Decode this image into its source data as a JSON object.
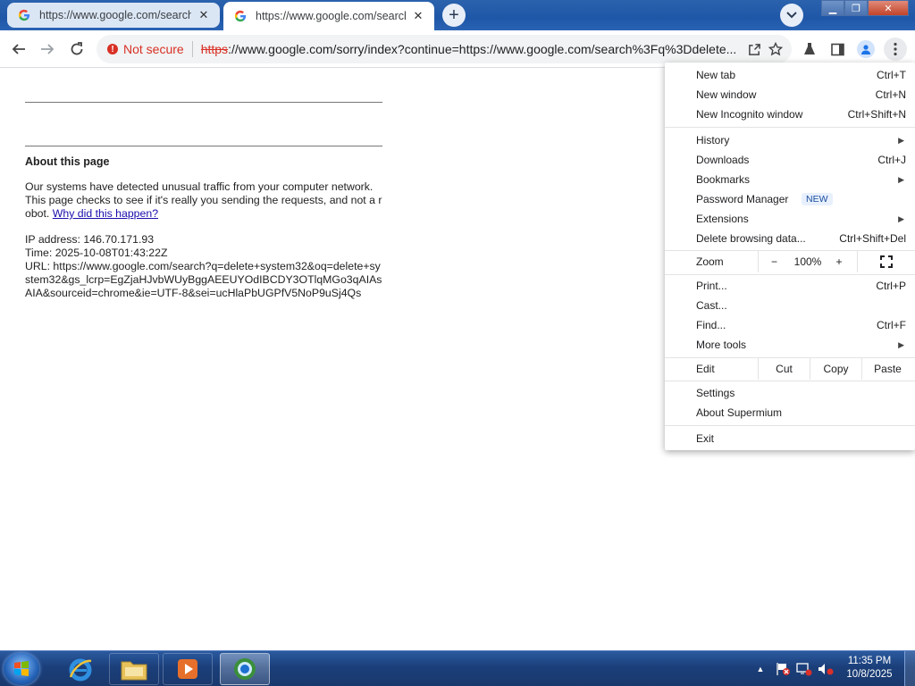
{
  "tabs": [
    {
      "title": "https://www.google.com/search?",
      "active": false
    },
    {
      "title": "https://www.google.com/search?",
      "active": true
    }
  ],
  "toolbar": {
    "security_label": "Not secure",
    "url_scheme": "https",
    "url_rest": "://www.google.com/sorry/index?continue=https://www.google.com/search%3Fq%3Ddelete..."
  },
  "page": {
    "heading": "About this page",
    "message": "Our systems have detected unusual traffic from your computer network. This page checks to see if it's really you sending the requests, and not a robot.",
    "link_text": "Why did this happen?",
    "ip_line": "IP address: 146.70.171.93",
    "time_line": "Time: 2025-10-08T01:43:22Z",
    "url_line": "URL: https://www.google.com/search?q=delete+system32&oq=delete+system32&gs_lcrp=EgZjaHJvbWUyBggAEEUYOdIBCDY3OTlqMGo3qAIAsAIA&sourceid=chrome&ie=UTF-8&sei=ucHlaPbUGPfV5NoP9uSj4Qs"
  },
  "menu": {
    "items": [
      {
        "label": "New tab",
        "shortcut": "Ctrl+T"
      },
      {
        "label": "New window",
        "shortcut": "Ctrl+N"
      },
      {
        "label": "New Incognito window",
        "shortcut": "Ctrl+Shift+N"
      },
      {
        "label": "History",
        "shortcut": ""
      },
      {
        "label": "Downloads",
        "shortcut": "Ctrl+J"
      },
      {
        "label": "Bookmarks",
        "shortcut": ""
      },
      {
        "label": "Password Manager",
        "shortcut": ""
      },
      {
        "label": "Extensions",
        "shortcut": ""
      },
      {
        "label": "Delete browsing data...",
        "shortcut": "Ctrl+Shift+Del"
      },
      {
        "label": "Print...",
        "shortcut": "Ctrl+P"
      },
      {
        "label": "Cast...",
        "shortcut": ""
      },
      {
        "label": "Find...",
        "shortcut": "Ctrl+F"
      },
      {
        "label": "More tools",
        "shortcut": ""
      },
      {
        "label": "Settings",
        "shortcut": ""
      },
      {
        "label": "About Supermium",
        "shortcut": ""
      },
      {
        "label": "Exit",
        "shortcut": ""
      }
    ],
    "new_badge": "NEW",
    "zoom": {
      "label": "Zoom",
      "minus": "−",
      "value": "100%",
      "plus": "+"
    },
    "edit": {
      "label": "Edit",
      "cut": "Cut",
      "copy": "Copy",
      "paste": "Paste"
    }
  },
  "taskbar": {
    "time": "11:35 PM",
    "date": "10/8/2025"
  },
  "colors": {
    "not_secure": "#d93025",
    "link": "#1a0dab",
    "taskbar": "#1b3f7a"
  }
}
